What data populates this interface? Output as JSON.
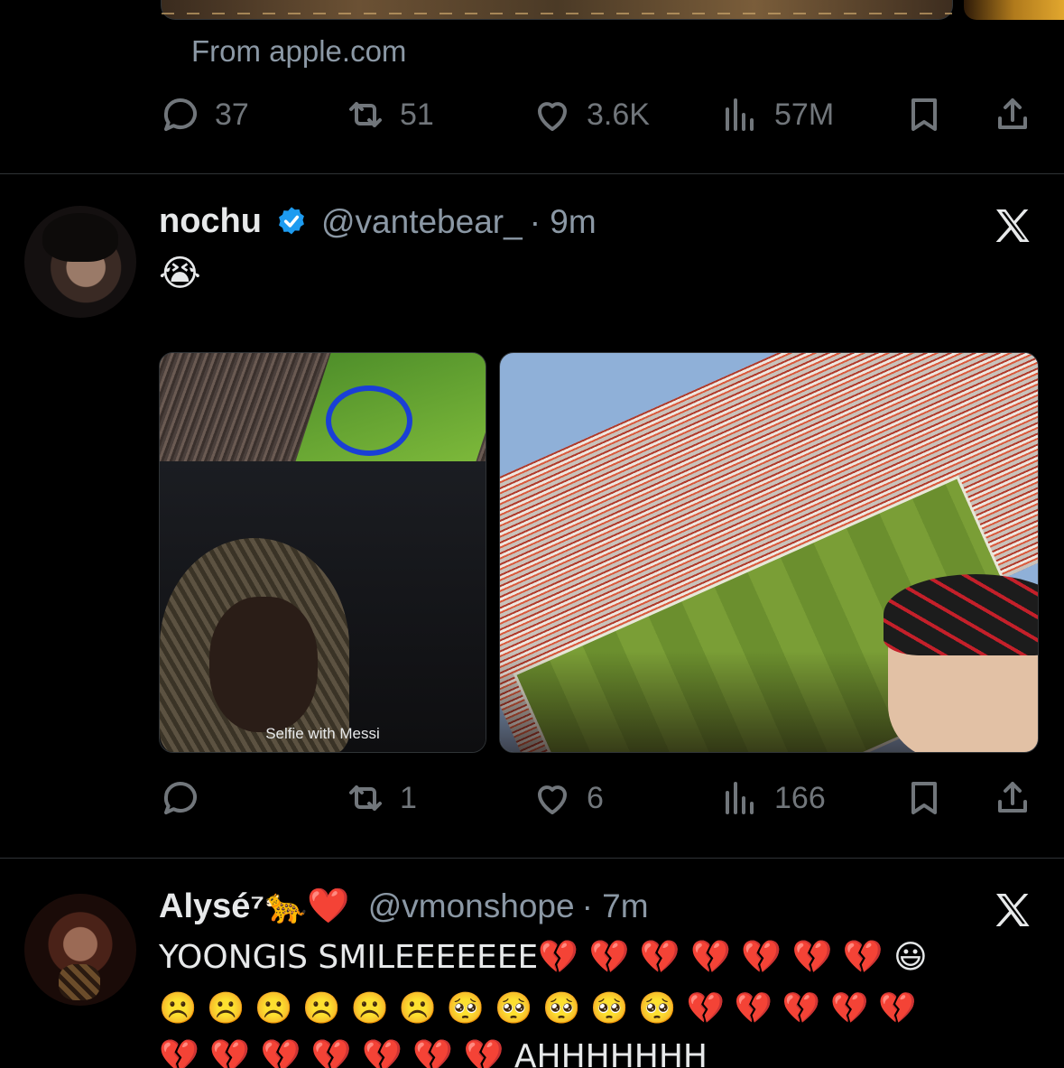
{
  "tweet_prev": {
    "source": "From apple.com",
    "actions": {
      "replies": "37",
      "reposts": "51",
      "likes": "3.6K",
      "views": "57M"
    }
  },
  "tweet1": {
    "name": "nochu",
    "handle": "@vantebear_",
    "time": "· 9m",
    "text": "😭",
    "media1_caption": "Selfie with Messi",
    "actions": {
      "replies": "",
      "reposts": "1",
      "likes": "6",
      "views": "166"
    }
  },
  "tweet2": {
    "name": "Alysé⁷🐆❤️",
    "handle": "@vmonshope",
    "time": "· 7m",
    "lines": [
      "YOONGIS SMILEEEEEEE💔 💔 💔 💔 💔 💔 💔 😃",
      "☹️ ☹️ ☹️ ☹️ ☹️ ☹️ 🥺 🥺 🥺 🥺 🥺 💔 💔 💔 💔 💔",
      "💔 💔 💔 💔 💔 💔 💔 AHHHHHHH"
    ]
  },
  "colors": {
    "background": "#000000",
    "text": "#e7e9ea",
    "muted": "#71767b",
    "verified": "#1d9bf0",
    "divider": "#2f3336"
  },
  "icons": [
    "reply-icon",
    "repost-icon",
    "like-icon",
    "views-icon",
    "bookmark-icon",
    "share-icon",
    "x-logo-icon",
    "verified-badge-icon"
  ]
}
